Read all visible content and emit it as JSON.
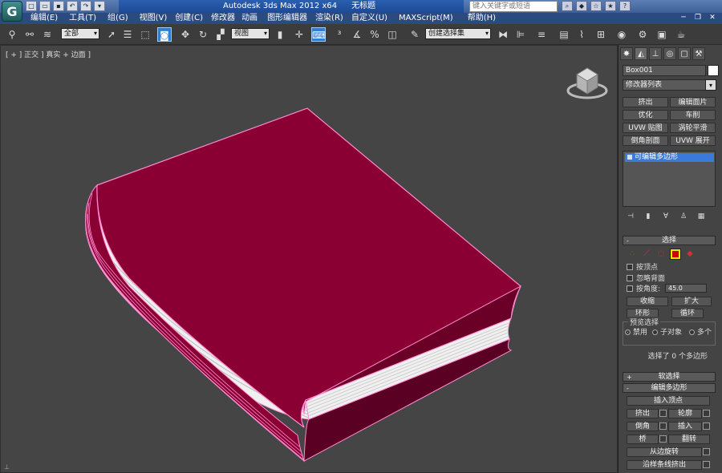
{
  "title_bar": {
    "app_title": "Autodesk 3ds Max  2012 x64",
    "document_title": "无标题",
    "search_placeholder": "键入关键字或短语",
    "logo_glyph": "G"
  },
  "menu": {
    "items": [
      "编辑(E)",
      "工具(T)",
      "组(G)",
      "视图(V)",
      "创建(C)",
      "修改器",
      "动画",
      "图形编辑器",
      "渲染(R)",
      "自定义(U)",
      "MAXScript(M)",
      "帮助(H)"
    ],
    "window_controls": [
      "─",
      "❐",
      "✕"
    ]
  },
  "toolbar": {
    "selection_filter": "全部",
    "reference_coord": "视图",
    "named_selection": "创建选择集"
  },
  "viewport": {
    "label": "[ + ] 正交 ] 真实 + 边面 ]",
    "book_color": "#8a0033",
    "pages_color": "#f2f2f2",
    "edge_color": "#ff8ad0"
  },
  "command_panel": {
    "object_name": "Box001",
    "modifier_list": "修改器列表",
    "modifier_buttons": [
      "挤出",
      "编辑面片",
      "优化",
      "车削",
      "UVW 贴图",
      "涡轮平滑",
      "倒角剖面",
      "UVW 展开"
    ],
    "stack_item": "可编辑多边形",
    "selection_rollout": {
      "title": "选择",
      "by_vertex": "按顶点",
      "ignore_backfacing": "忽略背面",
      "by_angle": "按角度:",
      "angle_value": "45.0",
      "shrink": "收缩",
      "grow": "扩大",
      "ring": "环形",
      "loop": "循环",
      "preview_title": "预览选择",
      "preview_options": [
        "禁用",
        "子对象",
        "多个"
      ],
      "status": "选择了 0 个多边形"
    },
    "soft_selection_title": "软选择",
    "edit_poly_rollout": {
      "title": "编辑多边形",
      "insert_vertex": "插入顶点",
      "extrude": "挤出",
      "outline": "轮廓",
      "bevel": "倒角",
      "inset": "插入",
      "bridge": "桥",
      "flip": "翻转",
      "hinge": "从边旋转",
      "extrude_spline": "沿样条线挤出"
    }
  }
}
